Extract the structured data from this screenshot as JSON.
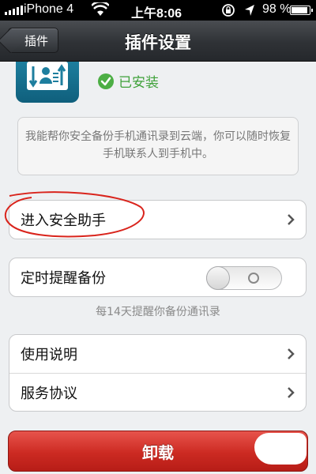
{
  "status_bar": {
    "carrier": "iPhone 4",
    "time": "上午8:06",
    "battery": "98 %",
    "battery_level": 0.98
  },
  "nav": {
    "back_label": "插件",
    "title": "插件设置"
  },
  "plugin": {
    "icon": "contact-backup-icon",
    "status": "已安装",
    "status_color": "#3fa13a",
    "description": "我能帮你安全备份手机通讯录到云端，你可以随时恢复手机联系人到手机中。"
  },
  "menu": {
    "enter_assistant": "进入安全助手",
    "scheduled_reminder": "定时提醒备份",
    "reminder_enabled": false,
    "reminder_hint": "每14天提醒你备份通讯录",
    "instructions": "使用说明",
    "agreement": "服务协议"
  },
  "uninstall_label": "卸载",
  "colors": {
    "accent_green": "#3fa13a",
    "danger_red": "#cc2a22",
    "annotation_red": "#d9241c"
  }
}
